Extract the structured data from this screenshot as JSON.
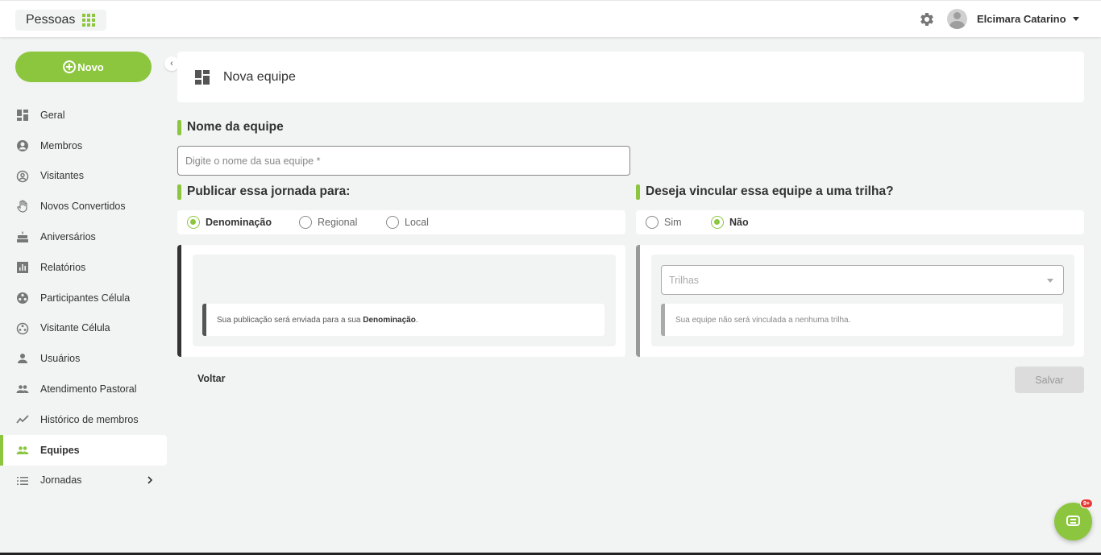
{
  "header": {
    "app_title": "Pessoas",
    "user_name": "Elcimara Catarino",
    "icons": {
      "apps": "grid-icon",
      "settings": "gear-icon",
      "avatar": "user-avatar",
      "menu": "caret-down-icon"
    }
  },
  "sidebar": {
    "new_button_label": "Novo",
    "items": [
      {
        "label": "Geral",
        "icon": "dashboard-icon"
      },
      {
        "label": "Membros",
        "icon": "account-circle-icon"
      },
      {
        "label": "Visitantes",
        "icon": "account-outline-icon"
      },
      {
        "label": "Novos Convertidos",
        "icon": "hand-icon"
      },
      {
        "label": "Aniversários",
        "icon": "cake-icon"
      },
      {
        "label": "Relatórios",
        "icon": "bar-chart-icon"
      },
      {
        "label": "Participantes Célula",
        "icon": "cell-icon"
      },
      {
        "label": "Visitante Célula",
        "icon": "cell-outline-icon"
      },
      {
        "label": "Usuários",
        "icon": "person-icon"
      },
      {
        "label": "Atendimento Pastoral",
        "icon": "people-icon"
      },
      {
        "label": "Histórico de membros",
        "icon": "trend-icon"
      },
      {
        "label": "Equipes",
        "icon": "team-icon",
        "active": true
      },
      {
        "label": "Jornadas",
        "icon": "list-icon"
      }
    ]
  },
  "main": {
    "page_title": "Nova equipe",
    "name_section_title": "Nome da equipe",
    "name_placeholder": "Digite o nome da sua equipe *",
    "publish_section_title": "Publicar essa jornada para:",
    "publish_options": [
      "Denominação",
      "Regional",
      "Local"
    ],
    "publish_selected": "Denominação",
    "publish_note_prefix": "Sua publicação será enviada para a sua ",
    "publish_note_bold": "Denominação",
    "publish_note_suffix": ".",
    "trail_section_title": "Deseja vincular essa equipe a uma trilha?",
    "trail_options": [
      "Sim",
      "Não"
    ],
    "trail_selected": "Não",
    "trail_select_placeholder": "Trilhas",
    "trail_note": "Sua equipe não será vinculada a nenhuma trilha.",
    "back_label": "Voltar",
    "save_label": "Salvar"
  },
  "chat": {
    "badge": "9+"
  },
  "colors": {
    "accent": "#8cc63f",
    "background": "#f2f3f3"
  }
}
